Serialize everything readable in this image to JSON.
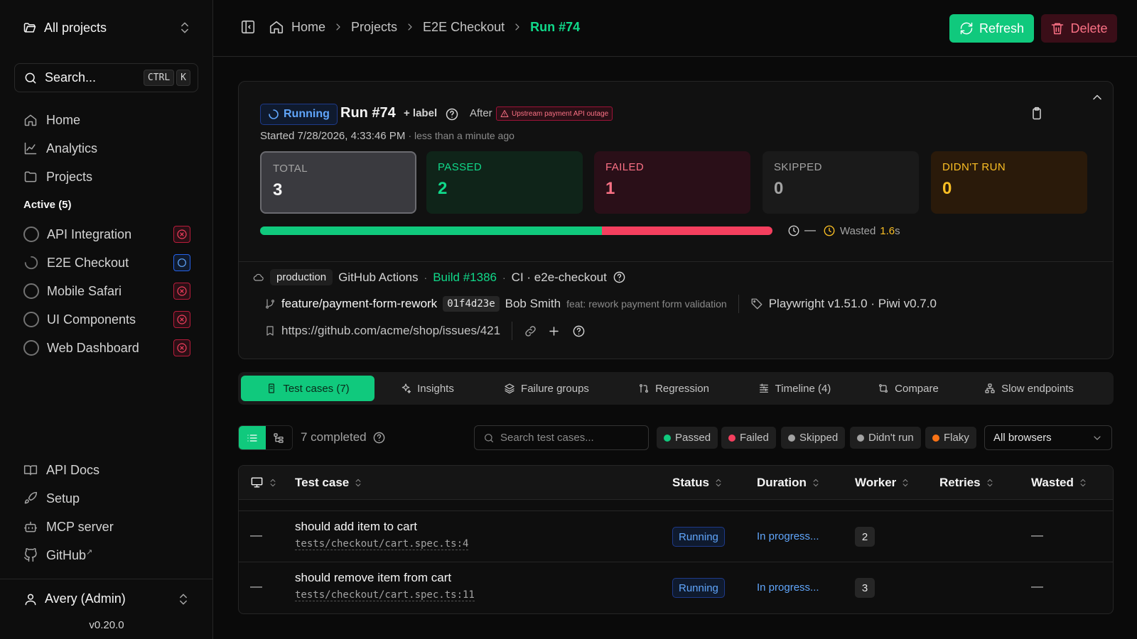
{
  "sidebar": {
    "project_switch": "All projects",
    "search": {
      "label": "Search...",
      "kbd1": "CTRL",
      "kbd2": "K"
    },
    "nav": [
      {
        "label": "Home",
        "icon": "home-icon"
      },
      {
        "label": "Analytics",
        "icon": "chart-icon"
      },
      {
        "label": "Projects",
        "icon": "folder-icon"
      }
    ],
    "active_title": "Active (5)",
    "active": [
      {
        "label": "API Integration",
        "state": "failed"
      },
      {
        "label": "E2E Checkout",
        "state": "running"
      },
      {
        "label": "Mobile Safari",
        "state": "failed"
      },
      {
        "label": "UI Components",
        "state": "failed"
      },
      {
        "label": "Web Dashboard",
        "state": "failed"
      }
    ],
    "bottom": [
      {
        "label": "API Docs",
        "icon": "book-icon"
      },
      {
        "label": "Setup",
        "icon": "rocket-icon"
      },
      {
        "label": "MCP server",
        "icon": "bot-icon"
      },
      {
        "label": "GitHub",
        "icon": "github-icon",
        "external": "↗"
      }
    ],
    "user": "Avery (Admin)",
    "version": "v0.20.0"
  },
  "header": {
    "breadcrumbs": [
      "Home",
      "Projects",
      "E2E Checkout"
    ],
    "current": "Run #74",
    "refresh": "Refresh",
    "delete": "Delete"
  },
  "run": {
    "status": "Running",
    "title": "Run #74",
    "add_label": "+ label",
    "after": "After",
    "outage": "Upstream payment API outage",
    "started": "Started 7/28/2026, 4:33:46 PM",
    "ago": "· less than a minute ago",
    "stats": {
      "total_label": "TOTAL",
      "total": "3",
      "passed_label": "PASSED",
      "passed": "2",
      "failed_label": "FAILED",
      "failed": "1",
      "skipped_label": "SKIPPED",
      "skipped": "0",
      "didnt_label": "DIDN'T RUN",
      "didnt": "0"
    },
    "progress": {
      "passed_fraction": 0.667,
      "failed_fraction": 0.333
    },
    "duration": "—",
    "wasted_label": "Wasted",
    "wasted_value": "1.6",
    "wasted_unit": "s",
    "env": "production",
    "ci_provider": "GitHub Actions",
    "build": "Build #1386",
    "ci_job": "CI · e2e-checkout",
    "branch": "feature/payment-form-rework",
    "sha": "01f4d23e",
    "author": "Bob Smith",
    "commit_msg": "feat: rework payment form validation",
    "versions": "Playwright v1.51.0 · Piwi v0.7.0",
    "issue_url": "https://github.com/acme/shop/issues/421"
  },
  "tabs": [
    {
      "label": "Test cases (7)",
      "icon": "test-tube-icon"
    },
    {
      "label": "Insights",
      "icon": "sparkles-icon"
    },
    {
      "label": "Failure groups",
      "icon": "layers-icon"
    },
    {
      "label": "Regression",
      "icon": "git-compare-icon"
    },
    {
      "label": "Timeline (4)",
      "icon": "timeline-icon"
    },
    {
      "label": "Compare",
      "icon": "compare-icon"
    },
    {
      "label": "Slow endpoints",
      "icon": "network-icon"
    }
  ],
  "toolbar": {
    "completed": "7 completed",
    "search_placeholder": "Search test cases...",
    "filters": [
      {
        "label": "Passed",
        "color": "#10c97d"
      },
      {
        "label": "Failed",
        "color": "#f43f5e"
      },
      {
        "label": "Skipped",
        "color": "#a3a3a3"
      },
      {
        "label": "Didn't run",
        "color": "#a3a3a3"
      },
      {
        "label": "Flaky",
        "color": "#f97316"
      }
    ],
    "browsers": "All browsers"
  },
  "table": {
    "headers": {
      "test_case": "Test case",
      "status": "Status",
      "duration": "Duration",
      "worker": "Worker",
      "retries": "Retries",
      "wasted": "Wasted"
    },
    "rows": [
      {
        "dash": "—",
        "name": "should add item to cart",
        "path": "tests/checkout/cart.spec.ts:4",
        "status": "Running",
        "duration": "In progress...",
        "worker": "2",
        "wasted": "—"
      },
      {
        "dash": "—",
        "name": "should remove item from cart",
        "path": "tests/checkout/cart.spec.ts:11",
        "status": "Running",
        "duration": "In progress...",
        "worker": "3",
        "wasted": "—"
      }
    ]
  }
}
